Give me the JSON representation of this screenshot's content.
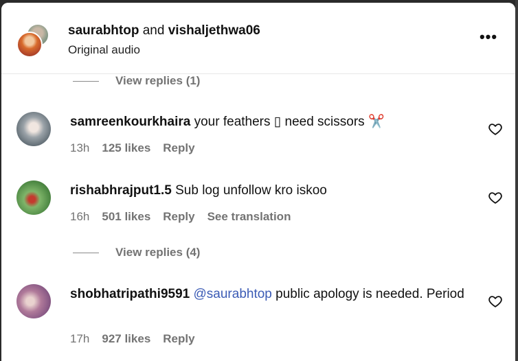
{
  "header": {
    "user1": "saurabhtop",
    "joiner": "and",
    "user2": "vishaljethwa06",
    "subtitle": "Original audio",
    "more_label": "•••"
  },
  "replies_top": {
    "label": "View replies (1)"
  },
  "comments": [
    {
      "username": "samreenkourkhaira",
      "text": "your feathers ▯ need scissors ✂️",
      "time": "13h",
      "likes": "125 likes",
      "reply": "Reply"
    },
    {
      "username": "rishabhrajput1.5",
      "text": "Sub log unfollow kro iskoo",
      "time": "16h",
      "likes": "501 likes",
      "reply": "Reply",
      "translate": "See translation"
    },
    {
      "username": "shobhatripathi9591",
      "mention": "@saurabhtop",
      "text": "public apology is needed. Period",
      "time": "17h",
      "likes": "927 likes",
      "reply": "Reply"
    }
  ],
  "replies_mid": {
    "label": "View replies (4)"
  },
  "colors": {
    "mention": "#3b5bb5",
    "muted": "#737373",
    "text": "#111111"
  },
  "icons": [
    "heart-icon",
    "more-icon"
  ]
}
